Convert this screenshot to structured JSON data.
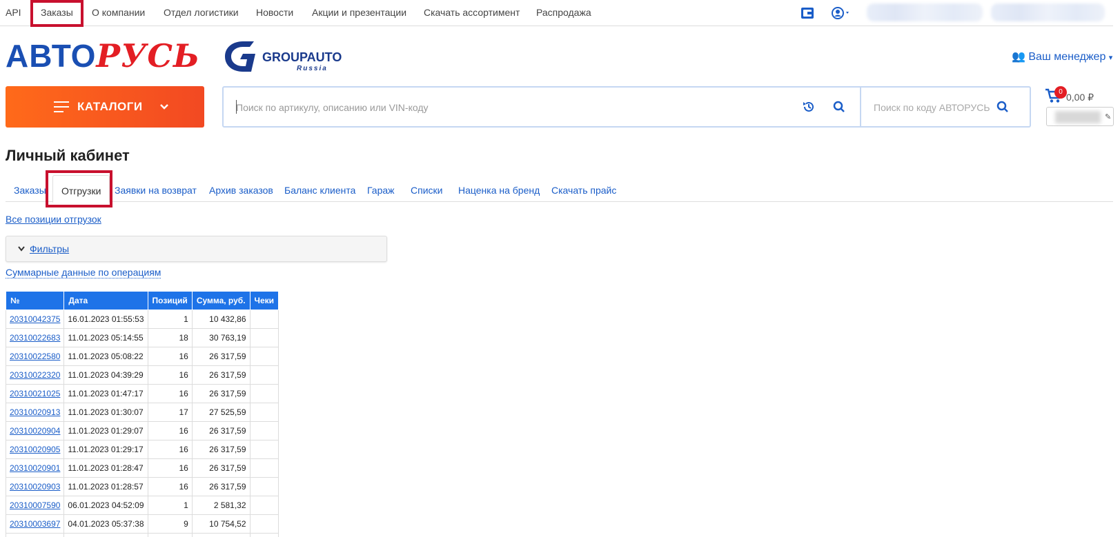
{
  "topnav": {
    "items": [
      "API",
      "Заказы",
      "О компании",
      "Отдел логистики",
      "Новости",
      "Акции и презентации",
      "Скачать ассортимент",
      "Распродажа"
    ]
  },
  "header": {
    "logo_part1": "АВТО",
    "logo_part2": "РУСЬ",
    "partner_logo_text": "GROUPAUTO",
    "partner_logo_sub": "Russia",
    "manager_label": "Ваш менеджер"
  },
  "catalog": {
    "label": "КАТАЛОГИ"
  },
  "search": {
    "main_placeholder": "Поиск по артикулу, описанию или VIN-коду",
    "code_placeholder": "Поиск по коду АВТОРУСЬ"
  },
  "cart": {
    "count": "0",
    "sum": "0,00 ₽"
  },
  "page": {
    "title": "Личный кабинет"
  },
  "tabs": [
    "Заказы",
    "Отгрузки",
    "Заявки на возврат",
    "Архив заказов",
    "Баланс клиента",
    "Гараж",
    "Списки",
    "Наценка на бренд",
    "Скачать прайс"
  ],
  "links": {
    "all_positions": "Все позиции отгрузок",
    "filters": "Фильтры",
    "summary": "Суммарные данные по операциям"
  },
  "table": {
    "headers": [
      "№",
      "Дата",
      "Позиций",
      "Сумма, руб.",
      "Чеки"
    ],
    "rows": [
      [
        "20310042375",
        "16.01.2023 01:55:53",
        "1",
        "10 432,86",
        ""
      ],
      [
        "20310022683",
        "11.01.2023 05:14:55",
        "18",
        "30 763,19",
        ""
      ],
      [
        "20310022580",
        "11.01.2023 05:08:22",
        "16",
        "26 317,59",
        ""
      ],
      [
        "20310022320",
        "11.01.2023 04:39:29",
        "16",
        "26 317,59",
        ""
      ],
      [
        "20310021025",
        "11.01.2023 01:47:17",
        "16",
        "26 317,59",
        ""
      ],
      [
        "20310020913",
        "11.01.2023 01:30:07",
        "17",
        "27 525,59",
        ""
      ],
      [
        "20310020904",
        "11.01.2023 01:29:07",
        "16",
        "26 317,59",
        ""
      ],
      [
        "20310020905",
        "11.01.2023 01:29:17",
        "16",
        "26 317,59",
        ""
      ],
      [
        "20310020901",
        "11.01.2023 01:28:47",
        "16",
        "26 317,59",
        ""
      ],
      [
        "20310020903",
        "11.01.2023 01:28:57",
        "16",
        "26 317,59",
        ""
      ],
      [
        "20310007590",
        "06.01.2023 04:52:09",
        "1",
        "2 581,32",
        ""
      ],
      [
        "20310003697",
        "04.01.2023 05:37:38",
        "9",
        "10 754,52",
        ""
      ],
      [
        "",
        "",
        "",
        "",
        ""
      ]
    ]
  },
  "colors": {
    "accent": "#1e73e8",
    "brand_red": "#e31e24",
    "catalog_orange": "#f24922",
    "highlight": "#c8102e"
  }
}
